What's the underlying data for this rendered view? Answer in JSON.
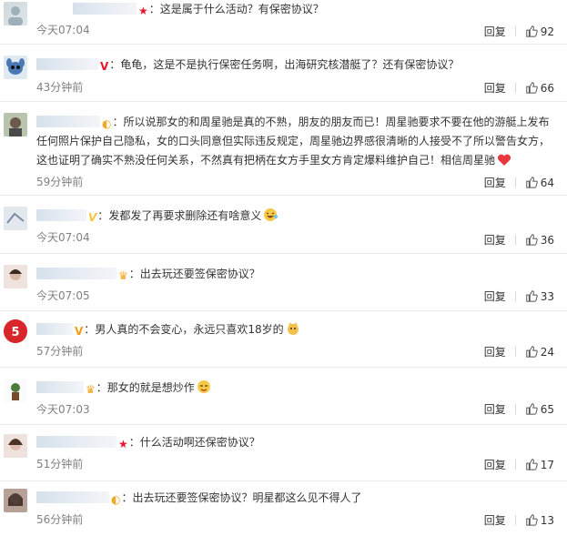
{
  "comments": [
    {
      "name_width": 70,
      "badge": "★",
      "badge_type": "star",
      "text": "这是属于什么活动？有保密协议？",
      "time": "今天07:04",
      "reply": "回复",
      "likes": "92"
    },
    {
      "name_width": 68,
      "badge": "V",
      "badge_type": "vred",
      "text": "龟龟，这是不是执行保密任务啊，出海研究核潜艇了？还有保密协议？",
      "time": "43分钟前",
      "reply": "回复",
      "likes": "66"
    },
    {
      "name_width": 70,
      "badge": "◐",
      "badge_type": "crown",
      "text": "所以说那女的和周星驰是真的不熟，朋友的朋友而已！周星驰要求不要在他的游艇上发布任何照片保护自己隐私，女的口头同意但实际违反规定，周星驰边界感很清晰的人接受不了所以警告女方，这也证明了确实不熟没任何关系，不然真有把柄在女方手里女方肯定爆料维护自己！相信周星驰",
      "time": "59分钟前",
      "reply": "回复",
      "likes": "64"
    },
    {
      "name_width": 55,
      "badge": "V",
      "badge_type": "vpale",
      "text": "发都发了再要求删除还有啥意义",
      "time": "今天07:04",
      "reply": "回复",
      "likes": "36"
    },
    {
      "name_width": 88,
      "badge": "♛",
      "badge_type": "crown",
      "text": "出去玩还要签保密协议？",
      "time": "今天07:05",
      "reply": "回复",
      "likes": "33"
    },
    {
      "name_width": 40,
      "badge": "V",
      "badge_type": "v",
      "text": "男人真的不会变心，永远只喜欢18岁的",
      "time": "57分钟前",
      "reply": "回复",
      "likes": "24"
    },
    {
      "name_width": 52,
      "badge": "♛",
      "badge_type": "crown",
      "text": "那女的就是想炒作",
      "time": "今天07:03",
      "reply": "回复",
      "likes": "65"
    },
    {
      "name_width": 88,
      "badge": "★",
      "badge_type": "star",
      "text": "什么活动啊还保密协议？",
      "time": "51分钟前",
      "reply": "回复",
      "likes": "17"
    },
    {
      "name_width": 80,
      "badge": "◐",
      "badge_type": "crown",
      "text": "出去玩还要签保密协议？明星都这么见不得人了",
      "time": "56分钟前",
      "reply": "回复",
      "likes": "13"
    }
  ]
}
